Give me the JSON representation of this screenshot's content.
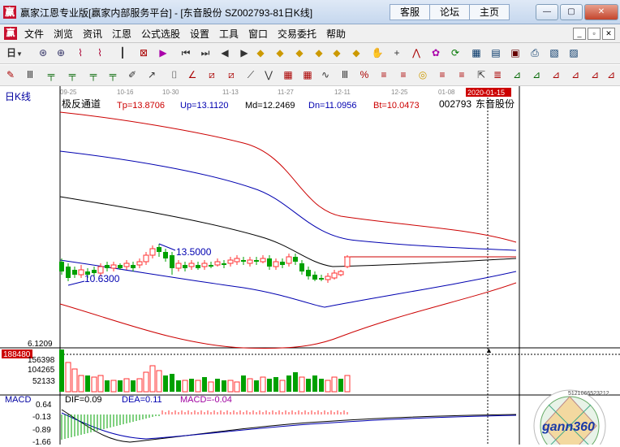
{
  "window": {
    "title": "赢家江恩专业版[赢家内部服务平台] - [东音股份   SZ002793-81日K线]",
    "links": [
      "客服",
      "论坛",
      "主页"
    ],
    "controls": [
      "—",
      "▢",
      "✕"
    ]
  },
  "menu": {
    "items": [
      "文件",
      "浏览",
      "资讯",
      "江恩",
      "公式选股",
      "设置",
      "工具",
      "窗口",
      "交易委托",
      "帮助"
    ],
    "mdi_controls": [
      "_",
      "▫",
      "✕"
    ]
  },
  "toolbar": {
    "period_label": "日"
  },
  "kline_header": {
    "panel_label": "日K线",
    "indicator": "极反通道",
    "tp": "Tp=13.8706",
    "up": "Up=13.1120",
    "md": "Md=12.2469",
    "dn": "Dn=11.0956",
    "bt": "Bt=10.0473",
    "code": "002793",
    "name": "东音股份"
  },
  "date_axis": {
    "labels": [
      "09-25",
      "10-16",
      "10-30",
      "11-13",
      "11-27",
      "12-11",
      "12-25",
      "01-08"
    ],
    "cursor_date": "2020-01-15"
  },
  "price_annotations": {
    "high": "13.5000",
    "low": "10.6300"
  },
  "volume_axis": {
    "labels": [
      "6.1209",
      "188480",
      "156398",
      "104265",
      "52133"
    ]
  },
  "macd_header": {
    "label": "MACD",
    "dif": "DIF=0.09",
    "dea": "DEA=0.11",
    "macd": "MACD=-0.04"
  },
  "macd_axis": {
    "labels": [
      "0.64",
      "-0.13",
      "-0.89",
      "-1.66"
    ]
  },
  "watermark": {
    "brand": "gann360",
    "ring_text": "5121066523212"
  },
  "colors": {
    "up": "#ff3030",
    "down": "#00a000",
    "band_outer": "#cc0000",
    "band_inner": "#0000b0",
    "mid": "#000000"
  }
}
